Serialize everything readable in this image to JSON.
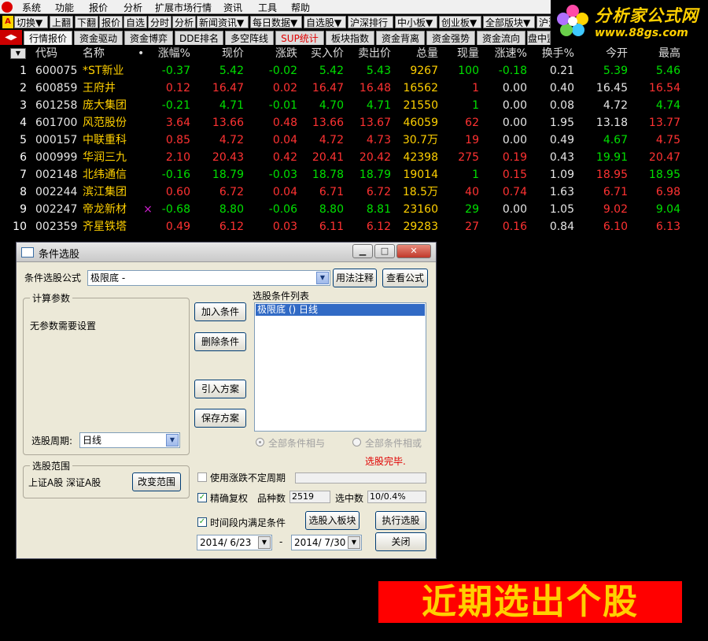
{
  "menubar": [
    "系统",
    "功能",
    "报价",
    "分析",
    "扩展市场行情",
    "资讯",
    "工具",
    "帮助"
  ],
  "toolbar": [
    "切换▼",
    "上翻",
    "下翻",
    "报价",
    "自选",
    "分时",
    "分析",
    "新闻资讯▼",
    "每日数据▼",
    "自选股▼",
    "沪深排行",
    "中小板▼",
    "创业板▼",
    "全部版块▼",
    "沪深"
  ],
  "brand": {
    "name": "分析家公式网",
    "url": "www.88gs.com"
  },
  "tabs": [
    "行情报价",
    "资金驱动",
    "资金博弈",
    "DDE排名",
    "多空阵线",
    "SUP统计",
    "板块指数",
    "资金背离",
    "资金强势",
    "资金流向",
    "盘中监"
  ],
  "quote_table": {
    "headers": [
      "代码",
      "名称",
      "•",
      "涨幅%",
      "现价",
      "涨跌",
      "买入价",
      "卖出价",
      "总量",
      "现量",
      "涨速%",
      "换手%",
      "今开",
      "最高"
    ],
    "rows": [
      {
        "no": "1",
        "code": "600075",
        "name": "*ST新业",
        "mark": "",
        "chg_pct": "-0.37",
        "price": "5.42",
        "chg": "-0.02",
        "bid": "5.42",
        "ask": "5.43",
        "vol": "9267",
        "cur": "100",
        "speed": "-0.18",
        "turn": "0.21",
        "open": "5.39",
        "high": "5.46"
      },
      {
        "no": "2",
        "code": "600859",
        "name": "王府井",
        "mark": "",
        "chg_pct": "0.12",
        "price": "16.47",
        "chg": "0.02",
        "bid": "16.47",
        "ask": "16.48",
        "vol": "16562",
        "cur": "1",
        "speed": "0.00",
        "turn": "0.40",
        "open": "16.45",
        "high": "16.54"
      },
      {
        "no": "3",
        "code": "601258",
        "name": "庞大集团",
        "mark": "",
        "chg_pct": "-0.21",
        "price": "4.71",
        "chg": "-0.01",
        "bid": "4.70",
        "ask": "4.71",
        "vol": "21550",
        "cur": "1",
        "speed": "0.00",
        "turn": "0.08",
        "open": "4.72",
        "high": "4.74"
      },
      {
        "no": "4",
        "code": "601700",
        "name": "风范股份",
        "mark": "",
        "chg_pct": "3.64",
        "price": "13.66",
        "chg": "0.48",
        "bid": "13.66",
        "ask": "13.67",
        "vol": "46059",
        "cur": "62",
        "speed": "0.00",
        "turn": "1.95",
        "open": "13.18",
        "high": "13.77"
      },
      {
        "no": "5",
        "code": "000157",
        "name": "中联重科",
        "mark": "",
        "chg_pct": "0.85",
        "price": "4.72",
        "chg": "0.04",
        "bid": "4.72",
        "ask": "4.73",
        "vol": "30.7万",
        "cur": "19",
        "speed": "0.00",
        "turn": "0.49",
        "open": "4.67",
        "high": "4.75"
      },
      {
        "no": "6",
        "code": "000999",
        "name": "华润三九",
        "mark": "",
        "chg_pct": "2.10",
        "price": "20.43",
        "chg": "0.42",
        "bid": "20.41",
        "ask": "20.42",
        "vol": "42398",
        "cur": "275",
        "speed": "0.19",
        "turn": "0.43",
        "open": "19.91",
        "high": "20.47"
      },
      {
        "no": "7",
        "code": "002148",
        "name": "北纬通信",
        "mark": "",
        "chg_pct": "-0.16",
        "price": "18.79",
        "chg": "-0.03",
        "bid": "18.78",
        "ask": "18.79",
        "vol": "19014",
        "cur": "1",
        "speed": "0.15",
        "turn": "1.09",
        "open": "18.95",
        "high": "18.95"
      },
      {
        "no": "8",
        "code": "002244",
        "name": "滨江集团",
        "mark": "",
        "chg_pct": "0.60",
        "price": "6.72",
        "chg": "0.04",
        "bid": "6.71",
        "ask": "6.72",
        "vol": "18.5万",
        "cur": "40",
        "speed": "0.74",
        "turn": "1.63",
        "open": "6.71",
        "high": "6.98"
      },
      {
        "no": "9",
        "code": "002247",
        "name": "帝龙新材",
        "mark": "×",
        "chg_pct": "-0.68",
        "price": "8.80",
        "chg": "-0.06",
        "bid": "8.80",
        "ask": "8.81",
        "vol": "23160",
        "cur": "29",
        "speed": "0.00",
        "turn": "1.05",
        "open": "9.02",
        "high": "9.04"
      },
      {
        "no": "10",
        "code": "002359",
        "name": "齐星铁塔",
        "mark": "",
        "chg_pct": "0.49",
        "price": "6.12",
        "chg": "0.03",
        "bid": "6.11",
        "ask": "6.12",
        "vol": "29283",
        "cur": "27",
        "speed": "0.16",
        "turn": "0.84",
        "open": "6.10",
        "high": "6.13"
      }
    ]
  },
  "dialog": {
    "title": "条件选股",
    "formula_label": "条件选股公式",
    "formula_value": "极限底   -",
    "usage_btn": "用法注释",
    "view_formula_btn": "查看公式",
    "calc_params_title": "计算参数",
    "no_params_text": "无参数需要设置",
    "period_label": "选股周期:",
    "period_value": "日线",
    "add_cond_btn": "加入条件",
    "del_cond_btn": "删除条件",
    "import_plan_btn": "引入方案",
    "save_plan_btn": "保存方案",
    "cond_list_label": "选股条件列表",
    "cond_items": [
      "极限底  () 日线"
    ],
    "radio_and": "全部条件相与",
    "radio_or": "全部条件相或",
    "status": "选股完毕.",
    "scope_title": "选股范围",
    "scope_text": "上证A股  深证A股",
    "change_scope_btn": "改变范围",
    "use_variable_period": "使用涨跌不定周期",
    "exact_rights": "精确复权",
    "count_label": "品种数",
    "count_value": "2519",
    "selected_label": "选中数",
    "selected_value": "10/0.4%",
    "time_range_label": "时间段内满足条件",
    "to_block_btn": "选股入板块",
    "execute_btn": "执行选股",
    "date_from": "2014/ 6/23",
    "date_sep": "-",
    "date_to": "2014/ 7/30",
    "close_btn": "关闭"
  },
  "banner": "近期选出个股",
  "colors": {
    "up": "#ff3232",
    "down": "#00e000",
    "neutral": "#e6e6e6",
    "code": "#e6e6e6",
    "name": "#ffd000",
    "volume": "#ffd000",
    "banner_bg": "#ff0000",
    "banner_text": "#ffd000"
  }
}
